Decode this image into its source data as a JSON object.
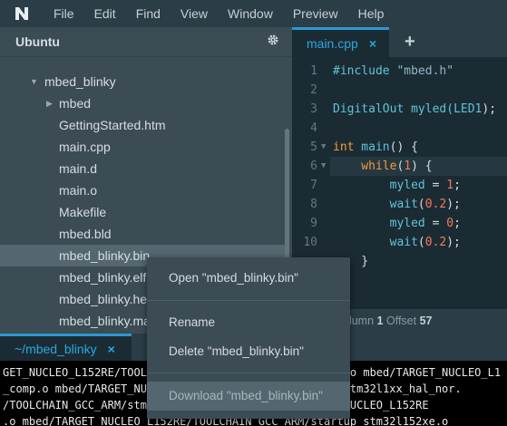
{
  "menubar": {
    "logo": "N",
    "items": [
      "File",
      "Edit",
      "Find",
      "View",
      "Window",
      "Preview",
      "Help"
    ]
  },
  "sidebar": {
    "title": "Ubuntu",
    "tree": [
      {
        "label": "mbed",
        "expanded": false,
        "folder": true
      },
      {
        "label": "mbed_blinky",
        "expanded": true,
        "folder": true
      },
      {
        "label": "mbed",
        "expanded": false,
        "folder": true
      },
      {
        "label": "GettingStarted.htm"
      },
      {
        "label": "main.cpp"
      },
      {
        "label": "main.d"
      },
      {
        "label": "main.o"
      },
      {
        "label": "Makefile"
      },
      {
        "label": "mbed.bld"
      },
      {
        "label": "mbed_blinky.bin",
        "selected": true
      },
      {
        "label": "mbed_blinky.elf"
      },
      {
        "label": "mbed_blinky.hex"
      },
      {
        "label": "mbed_blinky.map"
      }
    ]
  },
  "editor": {
    "tab_label": "main.cpp",
    "tab_close": "×",
    "add_tab": "+",
    "lines": [
      {
        "n": "1",
        "tokens": [
          {
            "t": "#include ",
            "c": "cyan"
          },
          {
            "t": "\"mbed.h\"",
            "c": "str"
          }
        ]
      },
      {
        "n": "2",
        "tokens": []
      },
      {
        "n": "3",
        "tokens": [
          {
            "t": "DigitalOut",
            "c": "cyan"
          },
          {
            "t": " myled(",
            "c": "cyan"
          },
          {
            "t": "LED1",
            "c": "cyan"
          },
          {
            "t": ");",
            "c": "plain"
          }
        ]
      },
      {
        "n": "4",
        "tokens": []
      },
      {
        "n": "5",
        "fold": true,
        "tokens": [
          {
            "t": "int",
            "c": "orange"
          },
          {
            "t": " main",
            "c": "cyan"
          },
          {
            "t": "() {",
            "c": "plain"
          }
        ]
      },
      {
        "n": "6",
        "fold": true,
        "tokens": [
          {
            "t": "    while",
            "c": "orange"
          },
          {
            "t": "(",
            "c": "plain"
          },
          {
            "t": "1",
            "c": "num"
          },
          {
            "t": ") {",
            "c": "plain"
          }
        ]
      },
      {
        "n": "7",
        "tokens": [
          {
            "t": "        myled",
            "c": "cyan"
          },
          {
            "t": " = ",
            "c": "plain"
          },
          {
            "t": "1",
            "c": "num"
          },
          {
            "t": ";",
            "c": "plain"
          }
        ]
      },
      {
        "n": "8",
        "tokens": [
          {
            "t": "        wait",
            "c": "cyan"
          },
          {
            "t": "(",
            "c": "plain"
          },
          {
            "t": "0.2",
            "c": "num"
          },
          {
            "t": ");",
            "c": "plain"
          }
        ]
      },
      {
        "n": "9",
        "tokens": [
          {
            "t": "        myled",
            "c": "cyan"
          },
          {
            "t": " = ",
            "c": "plain"
          },
          {
            "t": "0",
            "c": "num"
          },
          {
            "t": ";",
            "c": "plain"
          }
        ]
      },
      {
        "n": "10",
        "tokens": [
          {
            "t": "        wait",
            "c": "cyan"
          },
          {
            "t": "(",
            "c": "plain"
          },
          {
            "t": "0.2",
            "c": "num"
          },
          {
            "t": ");",
            "c": "plain"
          }
        ]
      },
      {
        "n": "",
        "tokens": [
          {
            "t": "    }",
            "c": "plain"
          }
        ]
      }
    ],
    "status": {
      "prefix": "olumn",
      "column": "1",
      "offset_label": "Offset",
      "offset": "57"
    }
  },
  "terminal": {
    "tab_label": "~/mbed_blinky",
    "tab_close": "×",
    "lines": [
      "GET_NUCLEO_L152RE/TOOLCHAIN_GCC_ARM/system_stm32l1xx.o mbed/TARGET_NUCLEO_L1",
      "_comp.o mbed/TARGET_NUCLEO_L152RE/TOOLCHAIN_GCC_ARM/stm32l1xx_hal_nor.",
      "/TOOLCHAIN_GCC_ARM/stm32l1xx_hal_nand.o mbed/TARGET_NUCLEO_L152RE",
      ".o mbed/TARGET_NUCLEO_L152RE/TOOLCHAIN_GCC_ARM/startup_stm32l152xe.o"
    ]
  },
  "context_menu": {
    "open": "Open \"mbed_blinky.bin\"",
    "rename": "Rename",
    "delete": "Delete \"mbed_blinky.bin\"",
    "download": "Download \"mbed_blinky.bin\""
  },
  "colors": {
    "accent": "#29a8e0",
    "keyword": "#f39c3a",
    "identifier": "#5fc4d6",
    "number": "#f47a5a"
  }
}
